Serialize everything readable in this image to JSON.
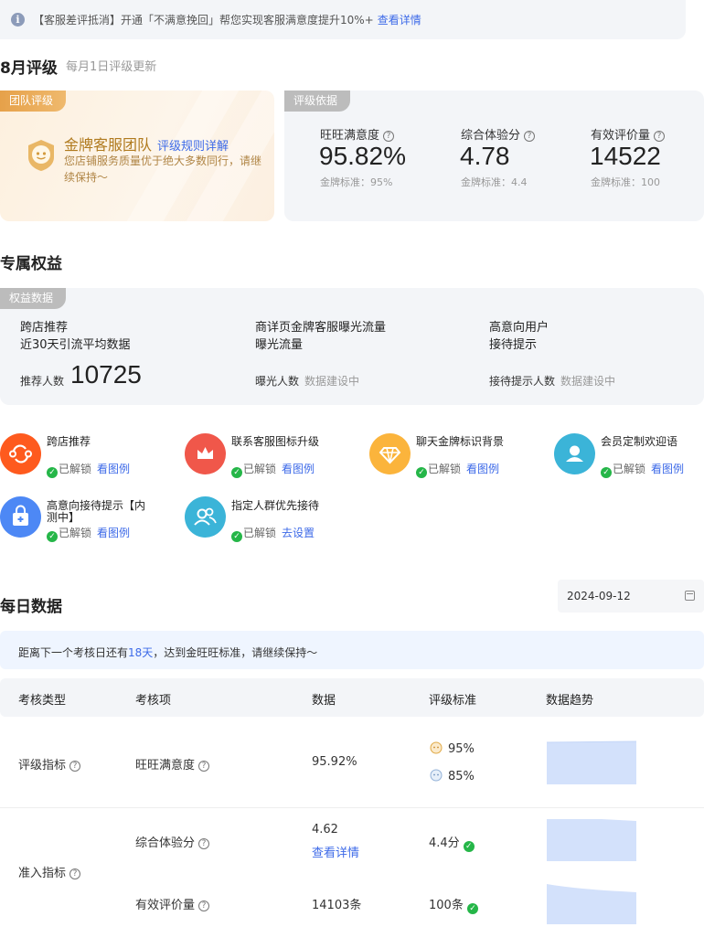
{
  "notice": {
    "text": "【客服差评抵消】开通「不满意挽回」帮您实现客服满意度提升10%+",
    "link": "查看详情"
  },
  "rating": {
    "title": "8月评级",
    "subtitle": "每月1日评级更新",
    "team_tag": "团队评级",
    "team_name": "金牌客服团队",
    "rules_link": "评级规则详解",
    "team_desc": "您店铺服务质量优于绝大多数同行，请继续保持～",
    "basis_tag": "评级依据",
    "metrics": [
      {
        "label": "旺旺满意度",
        "value": "95.82%",
        "std": "金牌标准：95%"
      },
      {
        "label": "综合体验分",
        "value": "4.78",
        "std": "金牌标准：4.4"
      },
      {
        "label": "有效评价量",
        "value": "14522",
        "std": "金牌标准：100"
      }
    ]
  },
  "rights": {
    "title": "专属权益",
    "data_tag": "权益数据",
    "cols": [
      {
        "title1": "跨店推荐",
        "title2": "近30天引流平均数据",
        "label": "推荐人数",
        "value": "10725"
      },
      {
        "title1": "商详页金牌客服曝光流量",
        "title2": "曝光流量",
        "label": "曝光人数",
        "value": "数据建设中"
      },
      {
        "title1": "高意向用户",
        "title2": "接待提示",
        "label": "接待提示人数",
        "value": "数据建设中"
      }
    ],
    "features": [
      {
        "name": "跨店推荐",
        "status": "已解锁",
        "link": "看图例",
        "icon": "cross-store-icon",
        "color": "#fe5a1e"
      },
      {
        "name": "联系客服图标升级",
        "status": "已解锁",
        "link": "看图例",
        "icon": "crown-icon",
        "color": "#f0574a"
      },
      {
        "name": "聊天金牌标识背景",
        "status": "已解锁",
        "link": "看图例",
        "icon": "diamond-icon",
        "color": "#fbb43c"
      },
      {
        "name": "会员定制欢迎语",
        "status": "已解锁",
        "link": "看图例",
        "icon": "member-icon",
        "color": "#3bb4d8"
      },
      {
        "name": "高意向接待提示【内",
        "name2": "测中】",
        "status": "已解锁",
        "link": "看图例",
        "icon": "bag-plus-icon",
        "color": "#4d88f5"
      },
      {
        "name": "指定人群优先接待",
        "status": "已解锁",
        "link": "去设置",
        "icon": "users-icon",
        "color": "#3bb4d8"
      }
    ]
  },
  "daily": {
    "title": "每日数据",
    "date": "2024-09-12",
    "tip_pre": "距离下一个考核日还有",
    "tip_days": "18天",
    "tip_post": "，达到金旺旺标准，请继续保持～",
    "headers": [
      "考核类型",
      "考核项",
      "数据",
      "评级标准",
      "数据趋势"
    ],
    "rows": {
      "r1_type": "评级指标",
      "r1_item": "旺旺满意度",
      "r1_data": "95.92%",
      "r1_std_gold": "95%",
      "r1_std_silver": "85%",
      "r2_type": "准入指标",
      "r2_item": "综合体验分",
      "r2_data": "4.62",
      "r2_link": "查看详情",
      "r2_std": "4.4分",
      "r3_item": "有效评价量",
      "r3_data": "14103条",
      "r3_std": "100条"
    }
  }
}
